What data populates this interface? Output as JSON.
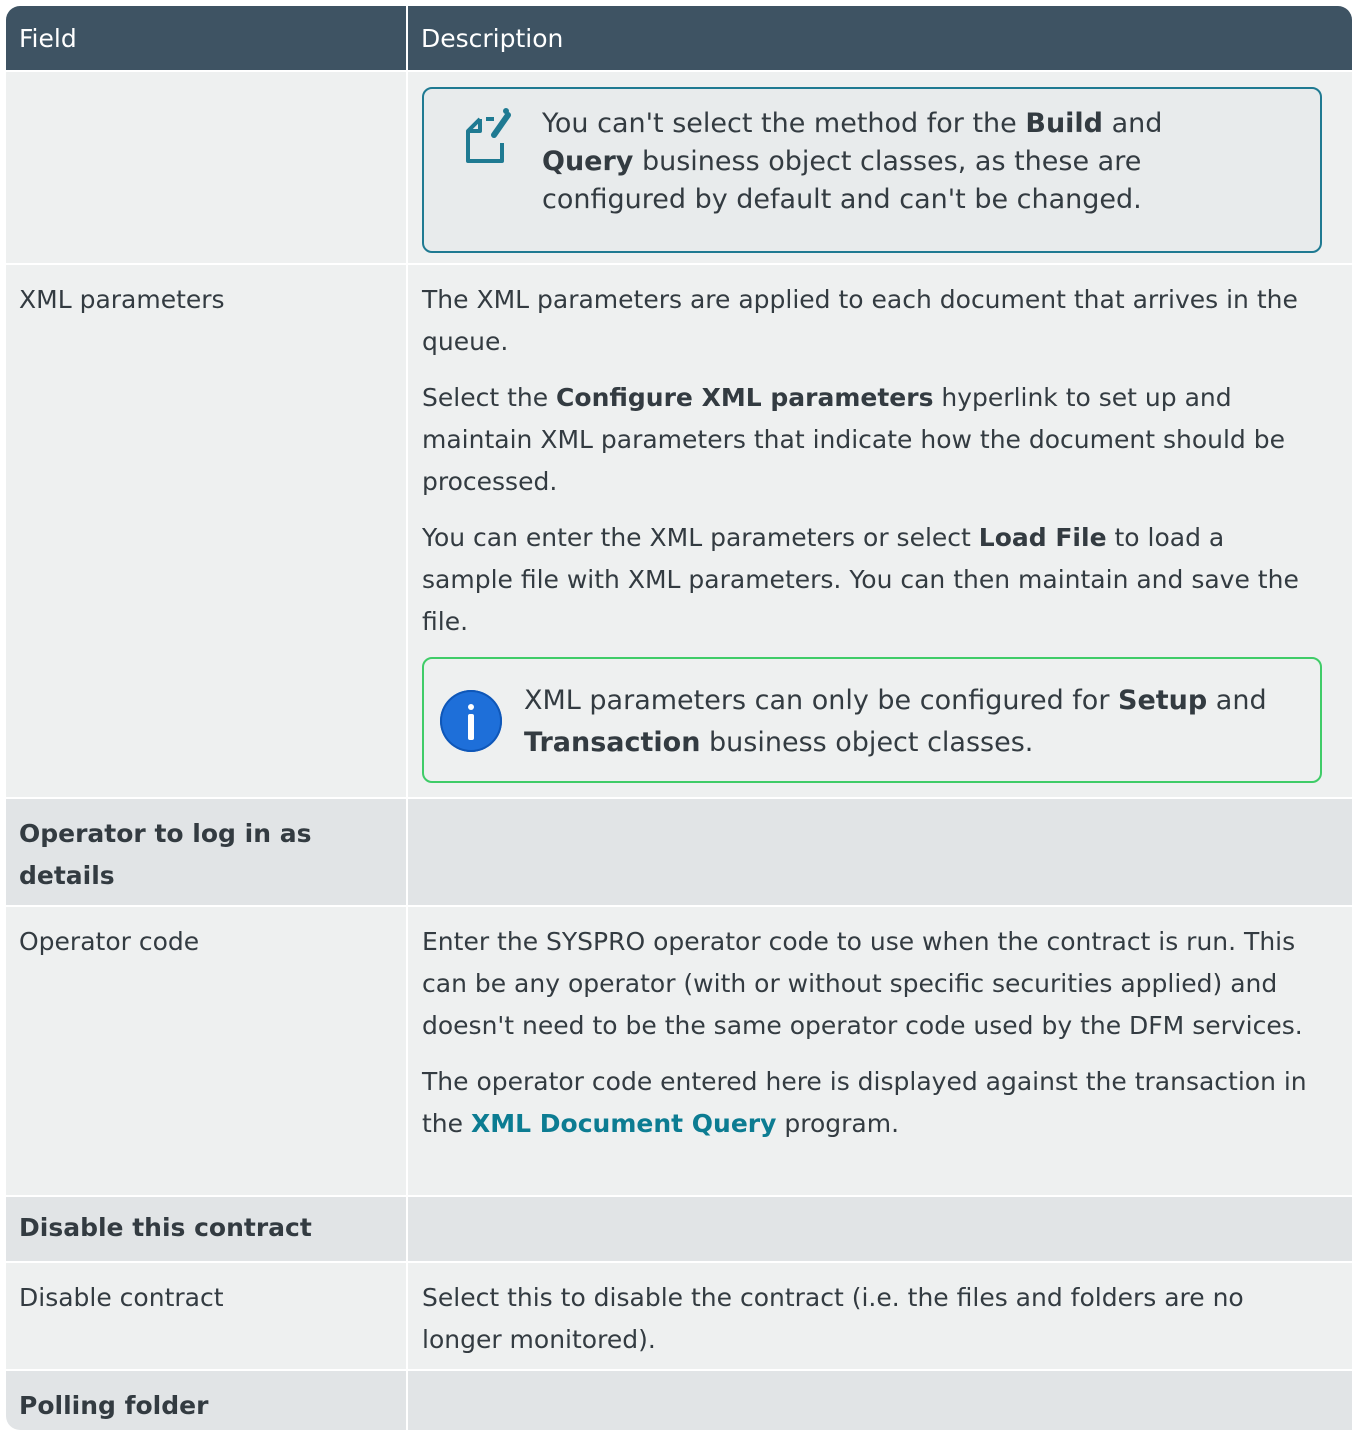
{
  "header": {
    "field": "Field",
    "description": "Description"
  },
  "note_row": {
    "icon": "note-edit-icon",
    "parts": [
      "You can't select the method for the ",
      "Build",
      " and ",
      "Query",
      " business object classes, as these are configured by default and can't be changed."
    ]
  },
  "xml_row": {
    "field": "XML parameters",
    "p1": "The XML parameters are applied to each document that arrives in the queue.",
    "p2": [
      "Select the ",
      "Configure XML parameters",
      " hyperlink to set up and maintain XML parameters that indicate how the document should be processed."
    ],
    "p3": [
      "You can enter the XML parameters or select ",
      "Load File",
      " to load a sample file with XML parameters. You can then maintain and save the file."
    ],
    "info": {
      "icon": "info-icon",
      "parts": [
        "XML parameters can only be configured for ",
        "Setup",
        " and ",
        "Transaction",
        " business object classes."
      ]
    }
  },
  "section_operator": {
    "field": "Operator to log in as details"
  },
  "operator_row": {
    "field": "Operator code",
    "p1": "Enter the SYSPRO operator code to use when the contract is run. This can be any operator (with or without specific securities applied) and doesn't need to be the same operator code used by the DFM services.",
    "p2": [
      "The operator code entered here is displayed against the transaction in the ",
      "XML Document Query",
      " program."
    ]
  },
  "section_disable": {
    "field": "Disable this contract"
  },
  "disable_row": {
    "field": "Disable contract",
    "description": "Select this to disable the contract (i.e. the files and folders are no longer monitored)."
  },
  "section_polling": {
    "field": "Polling folder"
  }
}
